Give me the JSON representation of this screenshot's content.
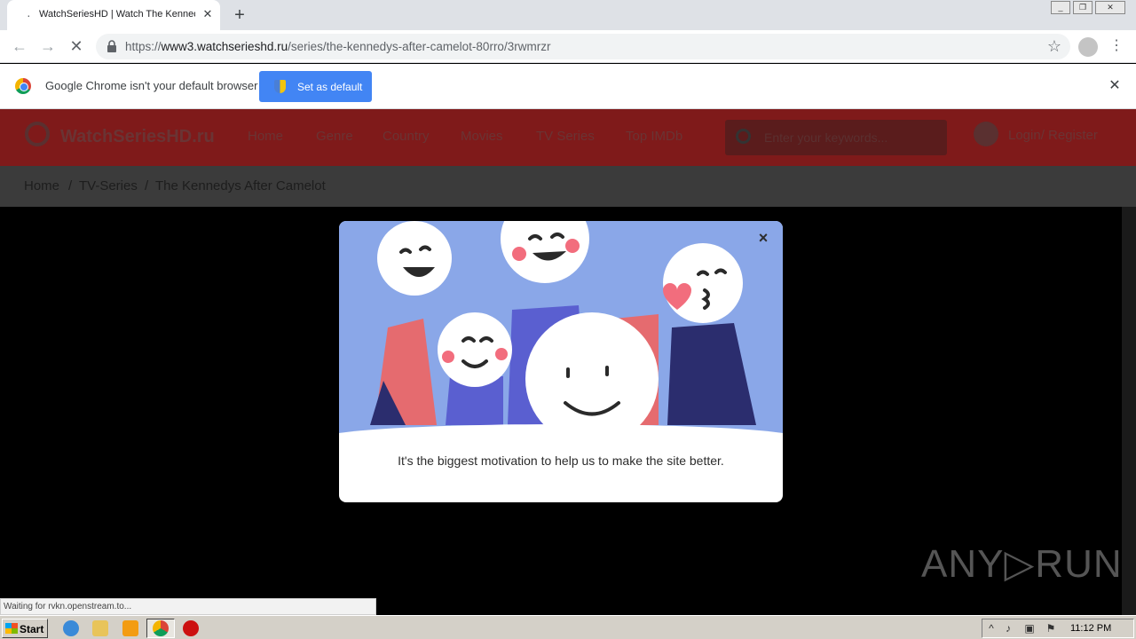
{
  "browser": {
    "tab_title": "WatchSeriesHD | Watch The Kennedys After Camelot",
    "url_scheme": "https://",
    "url_host": "www3.watchserieshd.ru",
    "url_path": "/series/the-kennedys-after-camelot-80rro/3rwmrzr",
    "infobar_text": "Google Chrome isn't your default browser",
    "set_default_label": "Set as default"
  },
  "site": {
    "logo": "WatchSeriesHD.ru",
    "nav": [
      "Home",
      "Genre",
      "Country",
      "Movies",
      "TV Series",
      "Top IMDb"
    ],
    "search_placeholder": "Enter your keywords...",
    "login": "Login/ Register",
    "breadcrumb": [
      "Home",
      "TV-Series",
      "The Kennedys After Camelot"
    ],
    "breadcrumb_sep": "/"
  },
  "modal": {
    "close": "×",
    "message": "It's the biggest motivation to help us to make the site better."
  },
  "status_text": "Waiting for rvkn.openstream.to...",
  "watermark": "ANY▷RUN",
  "taskbar": {
    "start": "Start",
    "clock": "11:12 PM"
  },
  "colors": {
    "header_bg": "#7f1a1a",
    "modal_illustration_bg": "#8aa7e8",
    "chrome_blue": "#4285f4"
  }
}
